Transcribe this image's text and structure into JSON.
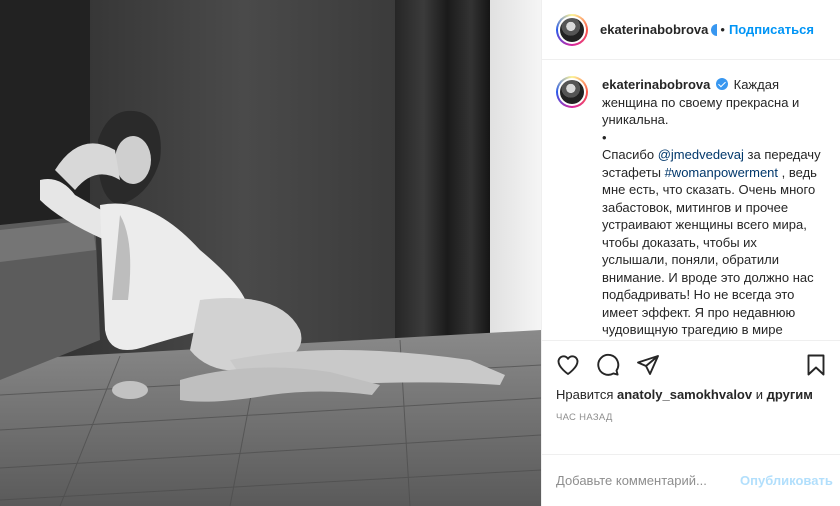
{
  "post": {
    "author": "ekaterinabobrova",
    "follow_label": "Подписаться",
    "header_separator": "•"
  },
  "caption": {
    "username": "ekaterinabobrova",
    "line1": "Каждая женщина по своему прекрасна и уникальна.",
    "bullet": "•",
    "thanks": "Спасибо ",
    "mention": "@jmedvedevaj",
    "after_mention": " за передачу эстафеты ",
    "hashtag": "#womanpowerment",
    "body": " , ведь мне есть, что сказать. Очень много забастовок, митингов и прочее устраивают женщины всего мира, чтобы доказать, чтобы их услышали, поняли, обратили внимание. И вроде это должно нас подбадривать! Но не всегда это имеет эффект. Я про недавнюю чудовищную трагедию в мире фигурного катания... Каждая женщина хоть капельки, но сомневается в себе. И это"
  },
  "actions": {
    "like_icon": "heart-icon",
    "comment_icon": "comment-icon",
    "share_icon": "share-icon",
    "save_icon": "bookmark-icon"
  },
  "likes": {
    "prefix": "Нравится ",
    "user": "anatoly_samokhvalov",
    "middle": " и ",
    "others": "другим"
  },
  "timestamp": "час назад",
  "comment_box": {
    "placeholder": "Добавьте комментарий...",
    "publish_label": "Опубликовать"
  },
  "colors": {
    "accent": "#0095f6",
    "verified": "#3897f0",
    "publish_disabled": "#b2dffc"
  }
}
